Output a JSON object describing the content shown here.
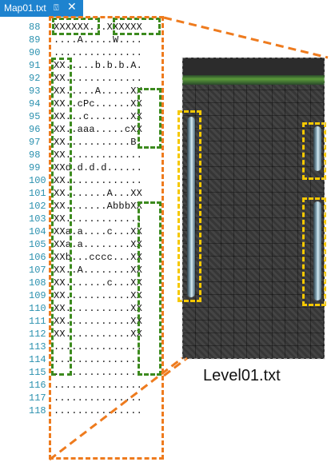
{
  "tab": {
    "label": "Map01.txt",
    "pin_icon": "pin-icon",
    "close_icon": "close-icon"
  },
  "editor": {
    "line_numbers": [
      "88",
      "89",
      "90",
      "91",
      "92",
      "93",
      "94",
      "95",
      "96",
      "97",
      "98",
      "99",
      "100",
      "101",
      "102",
      "103",
      "104",
      "105",
      "106",
      "107",
      "108",
      "109",
      "110",
      "111",
      "112",
      "113",
      "114",
      "115",
      "116",
      "117",
      "118"
    ],
    "lines": [
      "XXXXXX...XXXXXX",
      "....A.....W....",
      "...............",
      "XX.....b.b.b.A.",
      "XX.............",
      "XX.....A.....XX",
      "XX..cPc......XX",
      "XX...c.......XX",
      "XX..aaa.....cXX",
      "XX...........B.",
      "XX.............",
      "XXd.d.d.d......",
      "XX.............",
      "XX.......A...XX",
      "XX.......AbbbXX",
      "XX.............",
      "XXa.a....c...XX",
      "XXa.a........XX",
      "XXb...cccc...XX",
      "XX..A........XX",
      "XX.......c...XX",
      "XX...........XX",
      "XX...........XX",
      "XX...........XX",
      "XX...........XX",
      "...............",
      "...............",
      "...............",
      "...............",
      "...............",
      "..............."
    ]
  },
  "figure": {
    "caption": "Level01.txt",
    "colors": {
      "tab": "#1e83cf",
      "green_box": "#3c8a1e",
      "orange_box": "#ee7b1e",
      "yellow_box": "#f6c800",
      "line_number": "#2b91af"
    }
  }
}
